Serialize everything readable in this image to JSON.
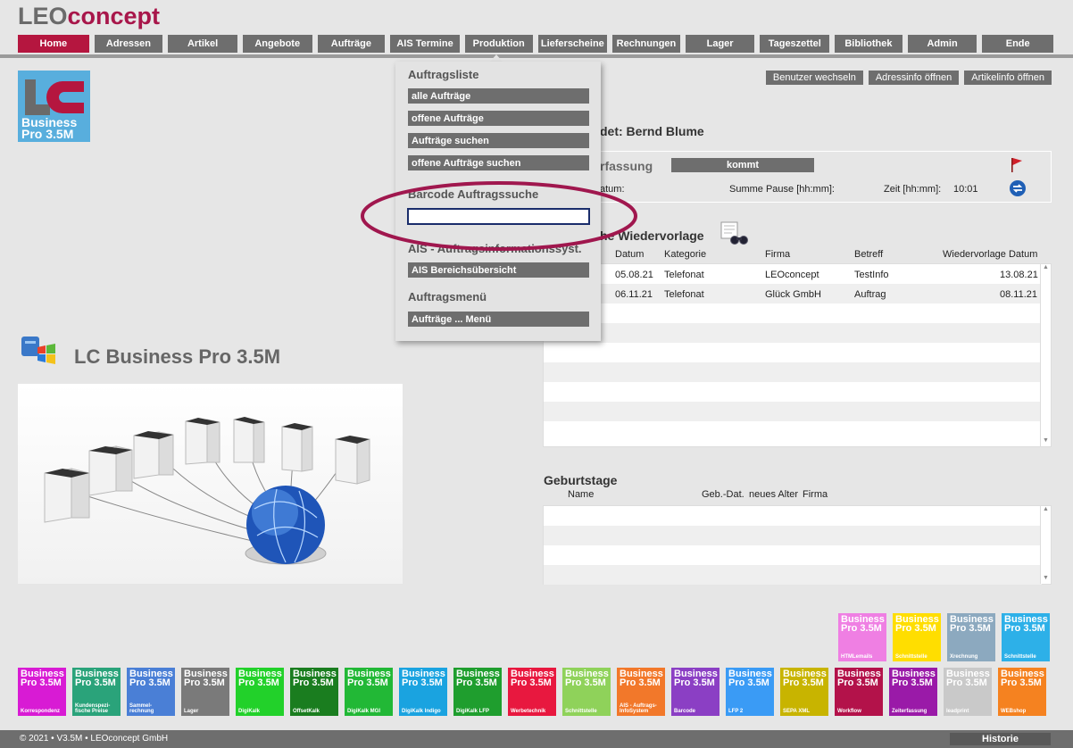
{
  "logo": {
    "leo": "LEO",
    "concept": "concept"
  },
  "nav": [
    {
      "label": "Home",
      "active": true
    },
    {
      "label": "Adressen"
    },
    {
      "label": "Artikel"
    },
    {
      "label": "Angebote"
    },
    {
      "label": "Aufträge"
    },
    {
      "label": "AIS Termine"
    },
    {
      "label": "Produktion"
    },
    {
      "label": "Lieferscheine"
    },
    {
      "label": "Rechnungen"
    },
    {
      "label": "Lager"
    },
    {
      "label": "Tageszettel"
    },
    {
      "label": "Bibliothek"
    },
    {
      "label": "Admin"
    },
    {
      "label": "Ende"
    }
  ],
  "top_actions": [
    "Benutzer wechseln",
    "Adressinfo öffnen",
    "Artikelinfo öffnen"
  ],
  "badge": {
    "line1": "Business",
    "line2": "Pro 3.5M",
    "letters": "LC"
  },
  "dropdown": {
    "heading1": "Auftragsliste",
    "items1": [
      "alle Aufträge",
      "offene Aufträge",
      "Aufträge suchen",
      "offene Aufträge suchen"
    ],
    "heading2": "Barcode Auftragssuche",
    "barcode_value": "",
    "heading3": "AIS - Auftragsinformationssyst.",
    "items3": [
      "AIS Bereichsübersicht"
    ],
    "heading4": "Auftragsmenü",
    "items4": [
      "Aufträge ... Menü"
    ]
  },
  "user": {
    "title": "det: Bernd Blume"
  },
  "zeit": {
    "label": "rfassung",
    "kommt": "kommt",
    "datum_label": "atum:",
    "pause_label": "Summe Pause [hh:mm]:",
    "zeit_label": "Zeit [hh:mm]:",
    "zeit_value": "10:01"
  },
  "wiedervorlage": {
    "title": "he Wiedervorlage",
    "columns": [
      "Datum",
      "Kategorie",
      "Firma",
      "Betreff",
      "Wiedervorlage Datum"
    ],
    "rows": [
      [
        "05.08.21",
        "Telefonat",
        "LEOconcept",
        "TestInfo",
        "13.08.21"
      ],
      [
        "06.11.21",
        "Telefonat",
        "Glück GmbH",
        "Auftrag",
        "08.11.21"
      ]
    ]
  },
  "brand_title": "LC Business Pro 3.5M",
  "geburtstage": {
    "title": "Geburtstage",
    "columns": [
      "Name",
      "Geb.-Dat.",
      "neues Alter",
      "Firma"
    ]
  },
  "tiles_top": [
    {
      "bp1": "Business",
      "bp2": "Pro 3.5M",
      "cap": "HTMLemails",
      "color": "#ef7fe3"
    },
    {
      "bp1": "Business",
      "bp2": "Pro 3.5M",
      "cap": "Schnittstelle",
      "color": "#ffde00"
    },
    {
      "bp1": "Business",
      "bp2": "Pro 3.5M",
      "cap": "Xrechnung",
      "color": "#8ca9bf"
    },
    {
      "bp1": "Business",
      "bp2": "Pro 3.5M",
      "cap": "Schnittstelle",
      "color": "#2db0e8"
    }
  ],
  "tiles_bottom": [
    {
      "bp1": "Business",
      "bp2": "Pro 3.5M",
      "cap": "Korrespondenz",
      "color": "#d81bd4"
    },
    {
      "bp1": "Business",
      "bp2": "Pro 3.5M",
      "cap": "Kundenspezi-fische Preise",
      "color": "#2aa37a"
    },
    {
      "bp1": "Business",
      "bp2": "Pro 3.5M",
      "cap": "Sammel-rechnung",
      "color": "#4a7fd6"
    },
    {
      "bp1": "Business",
      "bp2": "Pro 3.5M",
      "cap": "Lager",
      "color": "#7a7a7a"
    },
    {
      "bp1": "Business",
      "bp2": "Pro 3.5M",
      "cap": "DigiKalk",
      "color": "#22d12a"
    },
    {
      "bp1": "Business",
      "bp2": "Pro 3.5M",
      "cap": "OffsetKalk",
      "color": "#1a7d1f"
    },
    {
      "bp1": "Business",
      "bp2": "Pro 3.5M",
      "cap": "DigiKalk MGI",
      "color": "#22b836"
    },
    {
      "bp1": "Business",
      "bp2": "Pro 3.5M",
      "cap": "DigiKalk Indigo",
      "color": "#1aa3e0"
    },
    {
      "bp1": "Business",
      "bp2": "Pro 3.5M",
      "cap": "DigiKalk LFP",
      "color": "#1f9e2e"
    },
    {
      "bp1": "Business",
      "bp2": "Pro 3.5M",
      "cap": "Werbetechnik",
      "color": "#e8183f"
    },
    {
      "bp1": "Business",
      "bp2": "Pro 3.5M",
      "cap": "Schnittstelle",
      "color": "#8fd25a"
    },
    {
      "bp1": "Business",
      "bp2": "Pro 3.5M",
      "cap": "AIS - Auftrags-InfoSystem",
      "color": "#f2782a"
    },
    {
      "bp1": "Business",
      "bp2": "Pro 3.5M",
      "cap": "Barcode",
      "color": "#8b3fc4"
    },
    {
      "bp1": "Business",
      "bp2": "Pro 3.5M",
      "cap": "LFP 2",
      "color": "#3a9bf5"
    },
    {
      "bp1": "Business",
      "bp2": "Pro 3.5M",
      "cap": "SEPA XML",
      "color": "#c8b400"
    },
    {
      "bp1": "Business",
      "bp2": "Pro 3.5M",
      "cap": "Workflow",
      "color": "#b3124a"
    },
    {
      "bp1": "Business",
      "bp2": "Pro 3.5M",
      "cap": "Zeiterfassung",
      "color": "#9a1aa8"
    },
    {
      "bp1": "Business",
      "bp2": "Pro 3.5M",
      "cap": "leadprint",
      "color": "#c9c9c9"
    },
    {
      "bp1": "Business",
      "bp2": "Pro 3.5M",
      "cap": "WEBshop",
      "color": "#f58220"
    }
  ],
  "footer": {
    "copy": "© 2021 • V3.5M • LEOconcept GmbH",
    "historie": "Historie"
  },
  "colors": {
    "accent": "#b5163f",
    "button": "#6e6e6e",
    "brand": "#a8164a"
  }
}
